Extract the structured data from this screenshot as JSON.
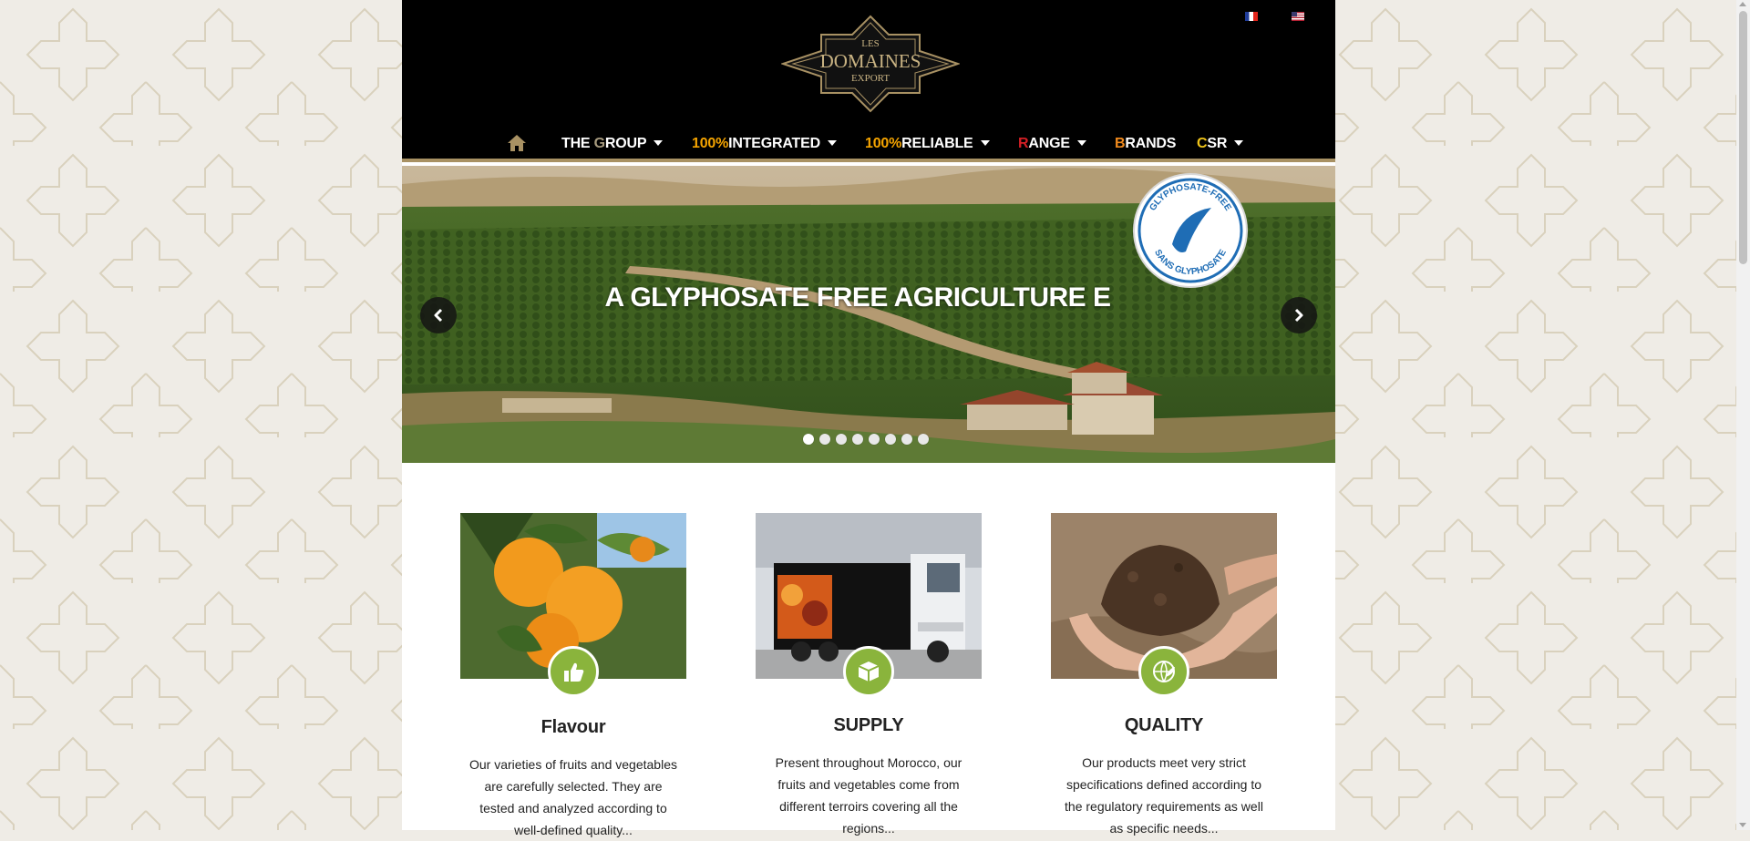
{
  "languages": [
    {
      "code": "fr",
      "flag": "french-flag-icon"
    },
    {
      "code": "en",
      "flag": "us-flag-icon"
    }
  ],
  "logo": {
    "line1": "LES",
    "line2": "DOMAINES",
    "line3": "EXPORT"
  },
  "nav": {
    "home_icon": "home-icon",
    "items": [
      {
        "prefix": "THE ",
        "accent": "G",
        "rest": "ROUP",
        "has_dropdown": true
      },
      {
        "accent": "100%",
        "rest": "INTEGRATED",
        "has_dropdown": true
      },
      {
        "accent": "100%",
        "rest": "RELIABLE",
        "has_dropdown": true
      },
      {
        "accent": "R",
        "rest": "ANGE",
        "has_dropdown": true
      },
      {
        "accent": "B",
        "rest": "RANDS",
        "has_dropdown": false
      },
      {
        "accent": "C",
        "rest": "SR",
        "has_dropdown": true
      }
    ],
    "accent_colors": {
      "gold": "#f5a400",
      "red": "#d51f25",
      "orange": "#f08a1d",
      "yellow": "#f0c419"
    }
  },
  "slider": {
    "caption": "A GLYPHOSATE FREE AGRICULTURE E",
    "badge": {
      "top_text": "GLYPHOSATE-FREE",
      "bottom_text": "SANS GLYPHOSATE"
    },
    "slide_count": 8,
    "active_slide": 1,
    "prev_icon": "chevron-left-icon",
    "next_icon": "chevron-right-icon"
  },
  "features": [
    {
      "title": "Flavour",
      "text": "Our varieties of fruits and vegetables are carefully selected. They are tested and analyzed according to well-defined quality...",
      "icon": "thumbs-up-icon"
    },
    {
      "title": "SUPPLY",
      "text": "Present throughout Morocco, our fruits and vegetables come from different terroirs covering all the regions...",
      "icon": "box-icon"
    },
    {
      "title": "QUALITY",
      "text": "Our products meet very strict specifications defined according to the regulatory requirements as well as specific needs...",
      "icon": "globe-leaf-icon"
    }
  ],
  "theme": {
    "brand_gold": "#a89163",
    "feature_green": "#8ab43c"
  }
}
